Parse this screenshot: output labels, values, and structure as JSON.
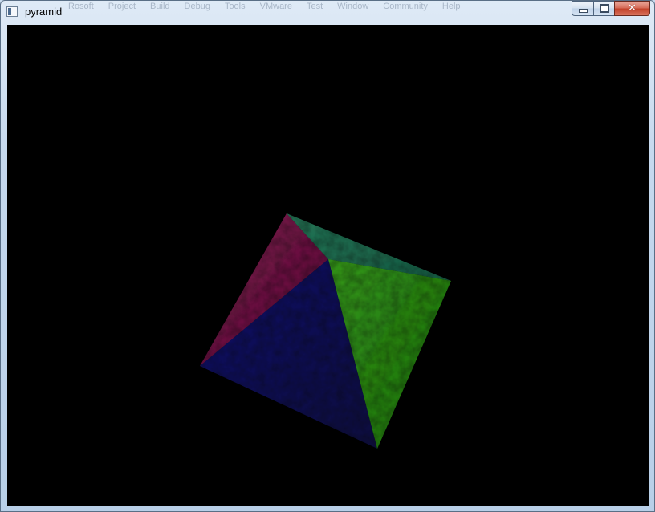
{
  "window": {
    "title": "pyramid",
    "background_menu_labels": [
      "Rosoft",
      "Project",
      "Build",
      "Debug",
      "Tools",
      "VMware",
      "Test",
      "Window",
      "Community",
      "Help"
    ],
    "icons": {
      "app": "window-app-icon",
      "minimize": "minimize-icon",
      "maximize": "maximize-icon",
      "close": "close-icon"
    }
  },
  "viewport": {
    "background": "#000000",
    "object": "textured-pyramid",
    "face_colors": {
      "magenta": "#8a1a55",
      "teal": "#2a8a66",
      "blue": "#14166e",
      "green": "#30b018"
    }
  }
}
